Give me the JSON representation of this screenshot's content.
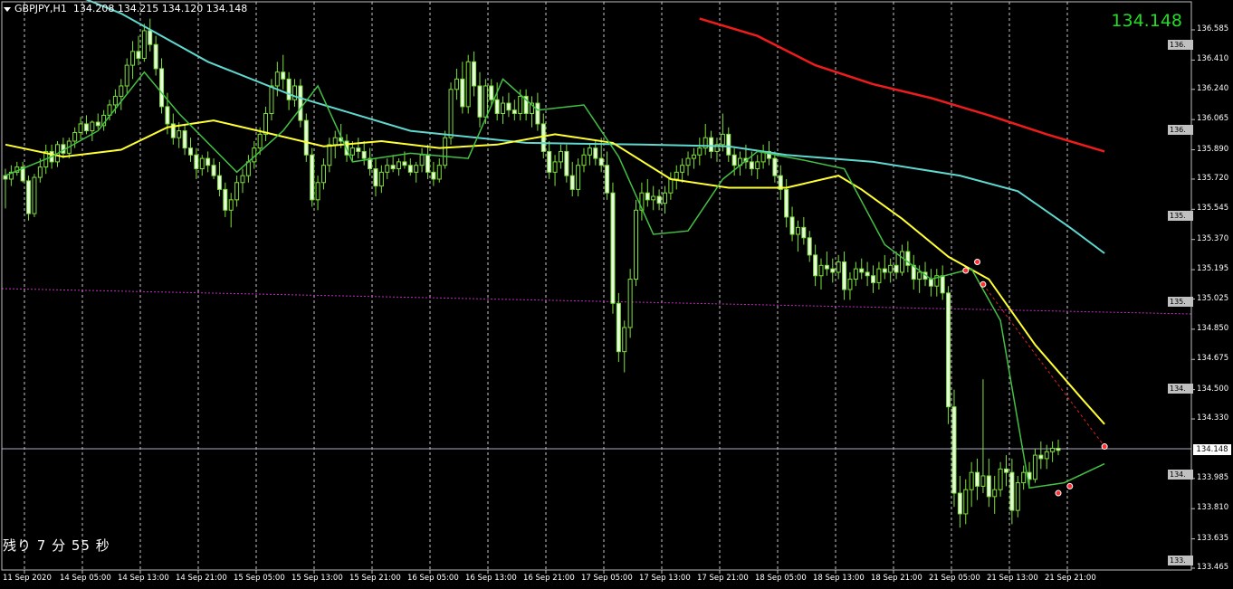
{
  "header": {
    "symbol_tf": "GBPJPY,H1",
    "ohlc": "134.208 134.215 134.120 134.148"
  },
  "big_price": "134.148",
  "countdown": "残り 7 分 55 秒",
  "current_price_tag": "134.148",
  "y_ticks": [
    "136.585",
    "136.410",
    "136.240",
    "136.065",
    "135.890",
    "135.720",
    "135.545",
    "135.370",
    "135.195",
    "135.025",
    "134.850",
    "134.675",
    "134.500",
    "134.330",
    "134.148",
    "133.985",
    "133.810",
    "133.635",
    "133.465"
  ],
  "x_ticks": [
    "11 Sep 2020",
    "14 Sep 05:00",
    "14 Sep 13:00",
    "14 Sep 21:00",
    "15 Sep 05:00",
    "15 Sep 13:00",
    "15 Sep 21:00",
    "16 Sep 05:00",
    "16 Sep 13:00",
    "16 Sep 21:00",
    "17 Sep 05:00",
    "17 Sep 13:00",
    "17 Sep 21:00",
    "18 Sep 05:00",
    "18 Sep 13:00",
    "18 Sep 21:00",
    "21 Sep 05:00",
    "21 Sep 13:00",
    "21 Sep 21:00"
  ],
  "level_tags": [
    "136.",
    "136.",
    "135.",
    "135.",
    "134.",
    "134.",
    "133."
  ],
  "colors": {
    "background": "#000000",
    "grid": "#c8c8c8",
    "candle": "#7ee03a",
    "ma_fast": "#44c144",
    "ma_mid": "#ffff33",
    "ma_slow": "#5fd8d0",
    "ma_long": "#ee1c1c",
    "level": "#c030c0",
    "price_line": "#aaaacc",
    "price_text": "#22dd22"
  },
  "chart_data": {
    "type": "candlestick",
    "symbol": "GBPJPY",
    "timeframe": "H1",
    "ylim": [
      133.465,
      136.65
    ],
    "last_price": 134.148,
    "horizontal_level": 134.99,
    "candles": [
      [
        135.74,
        135.78,
        135.55,
        135.72
      ],
      [
        135.72,
        135.8,
        135.68,
        135.76
      ],
      [
        135.76,
        135.82,
        135.74,
        135.79
      ],
      [
        135.79,
        135.82,
        135.7,
        135.71
      ],
      [
        135.71,
        135.74,
        135.48,
        135.52
      ],
      [
        135.52,
        135.75,
        135.5,
        135.73
      ],
      [
        135.73,
        135.84,
        135.7,
        135.79
      ],
      [
        135.79,
        135.92,
        135.75,
        135.88
      ],
      [
        135.88,
        135.92,
        135.78,
        135.82
      ],
      [
        135.82,
        135.94,
        135.79,
        135.92
      ],
      [
        135.92,
        135.96,
        135.84,
        135.87
      ],
      [
        135.87,
        135.96,
        135.84,
        135.94
      ],
      [
        135.94,
        136.02,
        135.9,
        135.99
      ],
      [
        135.99,
        136.08,
        135.95,
        136.04
      ],
      [
        136.04,
        136.09,
        135.98,
        136.0
      ],
      [
        136.0,
        136.06,
        135.94,
        136.05
      ],
      [
        136.05,
        136.1,
        136.01,
        136.03
      ],
      [
        136.03,
        136.12,
        136.0,
        136.09
      ],
      [
        136.09,
        136.18,
        136.06,
        136.15
      ],
      [
        136.15,
        136.24,
        136.1,
        136.2
      ],
      [
        136.2,
        136.3,
        136.12,
        136.26
      ],
      [
        136.26,
        136.42,
        136.22,
        136.38
      ],
      [
        136.38,
        136.52,
        136.3,
        136.46
      ],
      [
        136.46,
        136.55,
        136.38,
        136.42
      ],
      [
        136.42,
        136.62,
        136.4,
        136.58
      ],
      [
        136.58,
        136.65,
        136.46,
        136.5
      ],
      [
        136.5,
        136.55,
        136.32,
        136.36
      ],
      [
        136.36,
        136.42,
        136.1,
        136.14
      ],
      [
        136.14,
        136.22,
        135.98,
        136.04
      ],
      [
        136.04,
        136.1,
        135.92,
        135.96
      ],
      [
        135.96,
        136.05,
        135.9,
        136.0
      ],
      [
        136.0,
        136.04,
        135.86,
        135.9
      ],
      [
        135.9,
        135.96,
        135.82,
        135.86
      ],
      [
        135.86,
        135.9,
        135.72,
        135.78
      ],
      [
        135.78,
        135.86,
        135.74,
        135.84
      ],
      [
        135.84,
        135.88,
        135.76,
        135.8
      ],
      [
        135.8,
        135.84,
        135.72,
        135.74
      ],
      [
        135.74,
        135.82,
        135.62,
        135.66
      ],
      [
        135.66,
        135.7,
        135.5,
        135.54
      ],
      [
        135.54,
        135.64,
        135.44,
        135.6
      ],
      [
        135.6,
        135.74,
        135.56,
        135.7
      ],
      [
        135.7,
        135.78,
        135.64,
        135.74
      ],
      [
        135.74,
        135.86,
        135.7,
        135.82
      ],
      [
        135.82,
        135.94,
        135.78,
        135.9
      ],
      [
        135.9,
        136.02,
        135.86,
        135.98
      ],
      [
        135.98,
        136.14,
        135.94,
        136.1
      ],
      [
        136.1,
        136.3,
        136.06,
        136.26
      ],
      [
        136.26,
        136.4,
        136.2,
        136.34
      ],
      [
        136.34,
        136.44,
        136.24,
        136.3
      ],
      [
        136.3,
        136.34,
        136.12,
        136.18
      ],
      [
        136.18,
        136.3,
        136.14,
        136.26
      ],
      [
        136.26,
        136.3,
        136.02,
        136.06
      ],
      [
        136.06,
        136.1,
        135.82,
        135.86
      ],
      [
        135.86,
        135.9,
        135.56,
        135.6
      ],
      [
        135.6,
        135.74,
        135.54,
        135.7
      ],
      [
        135.7,
        135.84,
        135.66,
        135.8
      ],
      [
        135.8,
        135.96,
        135.76,
        135.92
      ],
      [
        135.92,
        136.0,
        135.84,
        135.96
      ],
      [
        135.96,
        136.04,
        135.9,
        135.94
      ],
      [
        135.94,
        135.98,
        135.82,
        135.86
      ],
      [
        135.86,
        135.94,
        135.82,
        135.9
      ],
      [
        135.9,
        135.96,
        135.84,
        135.88
      ],
      [
        135.88,
        135.94,
        135.8,
        135.84
      ],
      [
        135.84,
        135.9,
        135.74,
        135.78
      ],
      [
        135.78,
        135.84,
        135.62,
        135.68
      ],
      [
        135.68,
        135.8,
        135.64,
        135.76
      ],
      [
        135.76,
        135.84,
        135.72,
        135.8
      ],
      [
        135.8,
        135.86,
        135.76,
        135.78
      ],
      [
        135.78,
        135.84,
        135.74,
        135.82
      ],
      [
        135.82,
        135.88,
        135.78,
        135.8
      ],
      [
        135.8,
        135.84,
        135.74,
        135.76
      ],
      [
        135.76,
        135.82,
        135.7,
        135.8
      ],
      [
        135.8,
        135.9,
        135.76,
        135.86
      ],
      [
        135.86,
        135.92,
        135.72,
        135.76
      ],
      [
        135.76,
        135.82,
        135.68,
        135.72
      ],
      [
        135.72,
        135.84,
        135.7,
        135.8
      ],
      [
        135.8,
        136.0,
        135.78,
        135.96
      ],
      [
        135.96,
        136.28,
        135.92,
        136.24
      ],
      [
        136.24,
        136.36,
        136.18,
        136.3
      ],
      [
        136.3,
        136.4,
        136.1,
        136.14
      ],
      [
        136.14,
        136.44,
        136.1,
        136.4
      ],
      [
        136.4,
        136.46,
        136.2,
        136.26
      ],
      [
        136.26,
        136.34,
        136.02,
        136.08
      ],
      [
        136.08,
        136.3,
        136.04,
        136.26
      ],
      [
        136.26,
        136.3,
        136.14,
        136.18
      ],
      [
        136.18,
        136.28,
        136.06,
        136.1
      ],
      [
        136.1,
        136.2,
        136.04,
        136.16
      ],
      [
        136.16,
        136.22,
        136.08,
        136.12
      ],
      [
        136.12,
        136.18,
        136.06,
        136.1
      ],
      [
        136.1,
        136.24,
        136.06,
        136.2
      ],
      [
        136.2,
        136.24,
        136.06,
        136.1
      ],
      [
        136.1,
        136.2,
        136.02,
        136.16
      ],
      [
        136.16,
        136.22,
        136.0,
        136.04
      ],
      [
        136.04,
        136.1,
        135.84,
        135.88
      ],
      [
        135.88,
        135.94,
        135.72,
        135.76
      ],
      [
        135.76,
        135.86,
        135.68,
        135.82
      ],
      [
        135.82,
        135.92,
        135.78,
        135.88
      ],
      [
        135.88,
        135.92,
        135.7,
        135.74
      ],
      [
        135.74,
        135.82,
        135.62,
        135.66
      ],
      [
        135.66,
        135.84,
        135.62,
        135.8
      ],
      [
        135.8,
        135.9,
        135.76,
        135.86
      ],
      [
        135.86,
        135.92,
        135.8,
        135.9
      ],
      [
        135.9,
        135.94,
        135.8,
        135.84
      ],
      [
        135.84,
        135.96,
        135.76,
        135.8
      ],
      [
        135.8,
        135.88,
        135.6,
        135.64
      ],
      [
        135.64,
        135.7,
        134.94,
        135.0
      ],
      [
        135.0,
        135.06,
        134.66,
        134.72
      ],
      [
        134.72,
        134.9,
        134.6,
        134.86
      ],
      [
        134.86,
        135.2,
        134.8,
        135.14
      ],
      [
        135.14,
        135.6,
        135.1,
        135.54
      ],
      [
        135.54,
        135.7,
        135.48,
        135.64
      ],
      [
        135.64,
        135.72,
        135.56,
        135.6
      ],
      [
        135.6,
        135.68,
        135.54,
        135.62
      ],
      [
        135.62,
        135.66,
        135.54,
        135.58
      ],
      [
        135.58,
        135.68,
        135.52,
        135.64
      ],
      [
        135.64,
        135.76,
        135.6,
        135.72
      ],
      [
        135.72,
        135.8,
        135.66,
        135.76
      ],
      [
        135.76,
        135.84,
        135.7,
        135.8
      ],
      [
        135.8,
        135.88,
        135.74,
        135.84
      ],
      [
        135.84,
        135.9,
        135.78,
        135.86
      ],
      [
        135.86,
        135.96,
        135.8,
        135.9
      ],
      [
        135.9,
        136.04,
        135.86,
        135.96
      ],
      [
        135.96,
        136.0,
        135.84,
        135.88
      ],
      [
        135.88,
        135.96,
        135.82,
        135.92
      ],
      [
        135.92,
        136.1,
        135.88,
        135.98
      ],
      [
        135.98,
        136.02,
        135.82,
        135.86
      ],
      [
        135.86,
        135.9,
        135.74,
        135.8
      ],
      [
        135.8,
        135.88,
        135.74,
        135.84
      ],
      [
        135.84,
        135.92,
        135.78,
        135.82
      ],
      [
        135.82,
        135.88,
        135.74,
        135.78
      ],
      [
        135.78,
        135.86,
        135.72,
        135.82
      ],
      [
        135.82,
        135.92,
        135.78,
        135.88
      ],
      [
        135.88,
        135.94,
        135.8,
        135.84
      ],
      [
        135.84,
        135.88,
        135.7,
        135.74
      ],
      [
        135.74,
        135.8,
        135.6,
        135.66
      ],
      [
        135.66,
        135.72,
        135.44,
        135.5
      ],
      [
        135.5,
        135.56,
        135.36,
        135.4
      ],
      [
        135.4,
        135.48,
        135.3,
        135.44
      ],
      [
        135.44,
        135.5,
        135.34,
        135.38
      ],
      [
        135.38,
        135.42,
        135.24,
        135.28
      ],
      [
        135.28,
        135.34,
        135.1,
        135.16
      ],
      [
        135.16,
        135.26,
        135.08,
        135.22
      ],
      [
        135.22,
        135.3,
        135.16,
        135.2
      ],
      [
        135.2,
        135.26,
        135.12,
        135.18
      ],
      [
        135.18,
        135.28,
        135.14,
        135.24
      ],
      [
        135.24,
        135.3,
        135.02,
        135.08
      ],
      [
        135.08,
        135.18,
        135.02,
        135.14
      ],
      [
        135.14,
        135.24,
        135.1,
        135.2
      ],
      [
        135.2,
        135.26,
        135.14,
        135.18
      ],
      [
        135.18,
        135.24,
        135.1,
        135.16
      ],
      [
        135.16,
        135.22,
        135.06,
        135.12
      ],
      [
        135.12,
        135.24,
        135.08,
        135.2
      ],
      [
        135.2,
        135.28,
        135.14,
        135.18
      ],
      [
        135.18,
        135.26,
        135.12,
        135.22
      ],
      [
        135.22,
        135.3,
        135.14,
        135.18
      ],
      [
        135.18,
        135.34,
        135.16,
        135.3
      ],
      [
        135.3,
        135.36,
        135.18,
        135.22
      ],
      [
        135.22,
        135.28,
        135.08,
        135.14
      ],
      [
        135.14,
        135.22,
        135.06,
        135.18
      ],
      [
        135.18,
        135.24,
        135.1,
        135.14
      ],
      [
        135.14,
        135.2,
        135.04,
        135.1
      ],
      [
        135.1,
        135.2,
        135.04,
        135.16
      ],
      [
        135.16,
        135.22,
        135.02,
        135.06
      ],
      [
        135.06,
        135.1,
        134.3,
        134.4
      ],
      [
        134.4,
        134.5,
        133.82,
        133.9
      ],
      [
        133.9,
        134.0,
        133.7,
        133.78
      ],
      [
        133.78,
        133.98,
        133.72,
        133.92
      ],
      [
        133.92,
        134.08,
        133.82,
        134.02
      ],
      [
        134.02,
        134.1,
        133.86,
        133.94
      ],
      [
        133.94,
        134.56,
        133.9,
        134.0
      ],
      [
        134.0,
        134.1,
        133.82,
        133.88
      ],
      [
        133.88,
        134.0,
        133.78,
        133.92
      ],
      [
        133.92,
        134.08,
        133.88,
        134.04
      ],
      [
        134.04,
        134.12,
        133.94,
        134.02
      ],
      [
        134.02,
        134.1,
        133.72,
        133.8
      ],
      [
        133.8,
        134.0,
        133.76,
        133.96
      ],
      [
        133.96,
        134.06,
        133.92,
        134.02
      ],
      [
        134.02,
        134.08,
        133.94,
        133.98
      ],
      [
        133.98,
        134.16,
        133.96,
        134.12
      ],
      [
        134.12,
        134.2,
        134.04,
        134.1
      ],
      [
        134.1,
        134.18,
        134.04,
        134.14
      ],
      [
        134.14,
        134.2,
        134.08,
        134.16
      ],
      [
        134.16,
        134.21,
        134.12,
        134.148
      ]
    ],
    "ma_slow_points": [
      [
        0,
        136.95
      ],
      [
        20,
        136.68
      ],
      [
        35,
        136.4
      ],
      [
        50,
        136.2
      ],
      [
        70,
        136.0
      ],
      [
        90,
        135.93
      ],
      [
        110,
        135.92
      ],
      [
        125,
        135.91
      ],
      [
        135,
        135.86
      ],
      [
        150,
        135.82
      ],
      [
        165,
        135.74
      ],
      [
        175,
        135.65
      ],
      [
        184,
        135.44
      ],
      [
        190,
        135.29
      ]
    ],
    "ma_long_points": [
      [
        120,
        136.65
      ],
      [
        130,
        136.55
      ],
      [
        140,
        136.38
      ],
      [
        150,
        136.27
      ],
      [
        160,
        136.19
      ],
      [
        170,
        136.09
      ],
      [
        180,
        135.98
      ],
      [
        190,
        135.88
      ]
    ],
    "ma_mid_points": [
      [
        0,
        135.92
      ],
      [
        10,
        135.85
      ],
      [
        20,
        135.89
      ],
      [
        28,
        136.02
      ],
      [
        36,
        136.06
      ],
      [
        45,
        135.99
      ],
      [
        55,
        135.91
      ],
      [
        65,
        135.94
      ],
      [
        75,
        135.9
      ],
      [
        85,
        135.92
      ],
      [
        95,
        135.98
      ],
      [
        105,
        135.93
      ],
      [
        115,
        135.72
      ],
      [
        125,
        135.67
      ],
      [
        135,
        135.67
      ],
      [
        144,
        135.74
      ],
      [
        148,
        135.66
      ],
      [
        155,
        135.49
      ],
      [
        163,
        135.27
      ],
      [
        170,
        135.14
      ],
      [
        178,
        134.76
      ],
      [
        186,
        134.45
      ],
      [
        190,
        134.3
      ]
    ],
    "ma_fast_points": [
      [
        0,
        135.74
      ],
      [
        8,
        135.85
      ],
      [
        16,
        136.0
      ],
      [
        24,
        136.34
      ],
      [
        30,
        136.1
      ],
      [
        40,
        135.76
      ],
      [
        48,
        136.0
      ],
      [
        54,
        136.26
      ],
      [
        60,
        135.82
      ],
      [
        70,
        135.87
      ],
      [
        80,
        135.84
      ],
      [
        86,
        136.3
      ],
      [
        92,
        136.12
      ],
      [
        100,
        136.15
      ],
      [
        106,
        135.85
      ],
      [
        112,
        135.4
      ],
      [
        118,
        135.42
      ],
      [
        124,
        135.72
      ],
      [
        130,
        135.88
      ],
      [
        138,
        135.83
      ],
      [
        145,
        135.78
      ],
      [
        152,
        135.34
      ],
      [
        160,
        135.14
      ],
      [
        167,
        135.2
      ],
      [
        172,
        134.9
      ],
      [
        177,
        133.93
      ],
      [
        183,
        133.96
      ],
      [
        190,
        134.07
      ]
    ],
    "signal_markers": [
      [
        166,
        135.19
      ],
      [
        168,
        135.24
      ],
      [
        169,
        135.11
      ],
      [
        182,
        133.9
      ],
      [
        184,
        133.94
      ],
      [
        190,
        134.17
      ]
    ],
    "signal_line": [
      [
        169,
        135.11
      ],
      [
        190,
        134.17
      ]
    ]
  }
}
